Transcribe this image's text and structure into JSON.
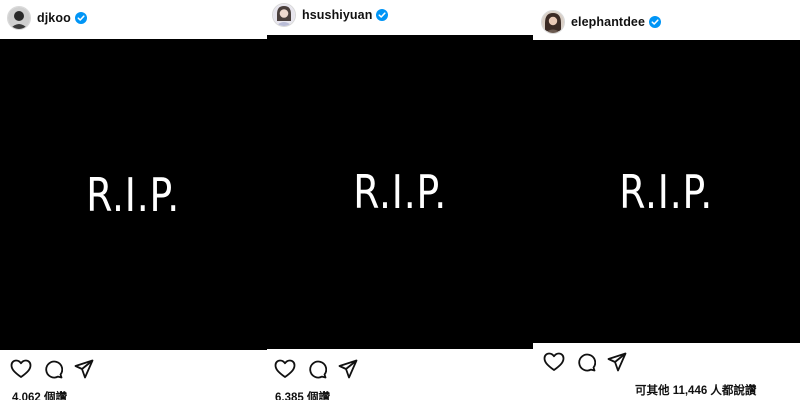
{
  "posts": [
    {
      "username": "djkoo",
      "verified": true,
      "image_text": "R.I.P.",
      "views": "4,062 個讚"
    },
    {
      "username": "hsushiyuan",
      "verified": true,
      "image_text": "R.I.P.",
      "views": "6,385 個讚"
    },
    {
      "username": "elephantdee",
      "verified": true,
      "image_text": "R.I.P.",
      "views": "可其他 11,446 人都說讚"
    }
  ],
  "icons": [
    "heart-icon",
    "comment-icon",
    "share-icon",
    "verified-badge-icon"
  ],
  "colors": {
    "verified": "#0095f6",
    "image_bg": "#000000",
    "image_text": "#ffffff",
    "text": "#111111"
  }
}
